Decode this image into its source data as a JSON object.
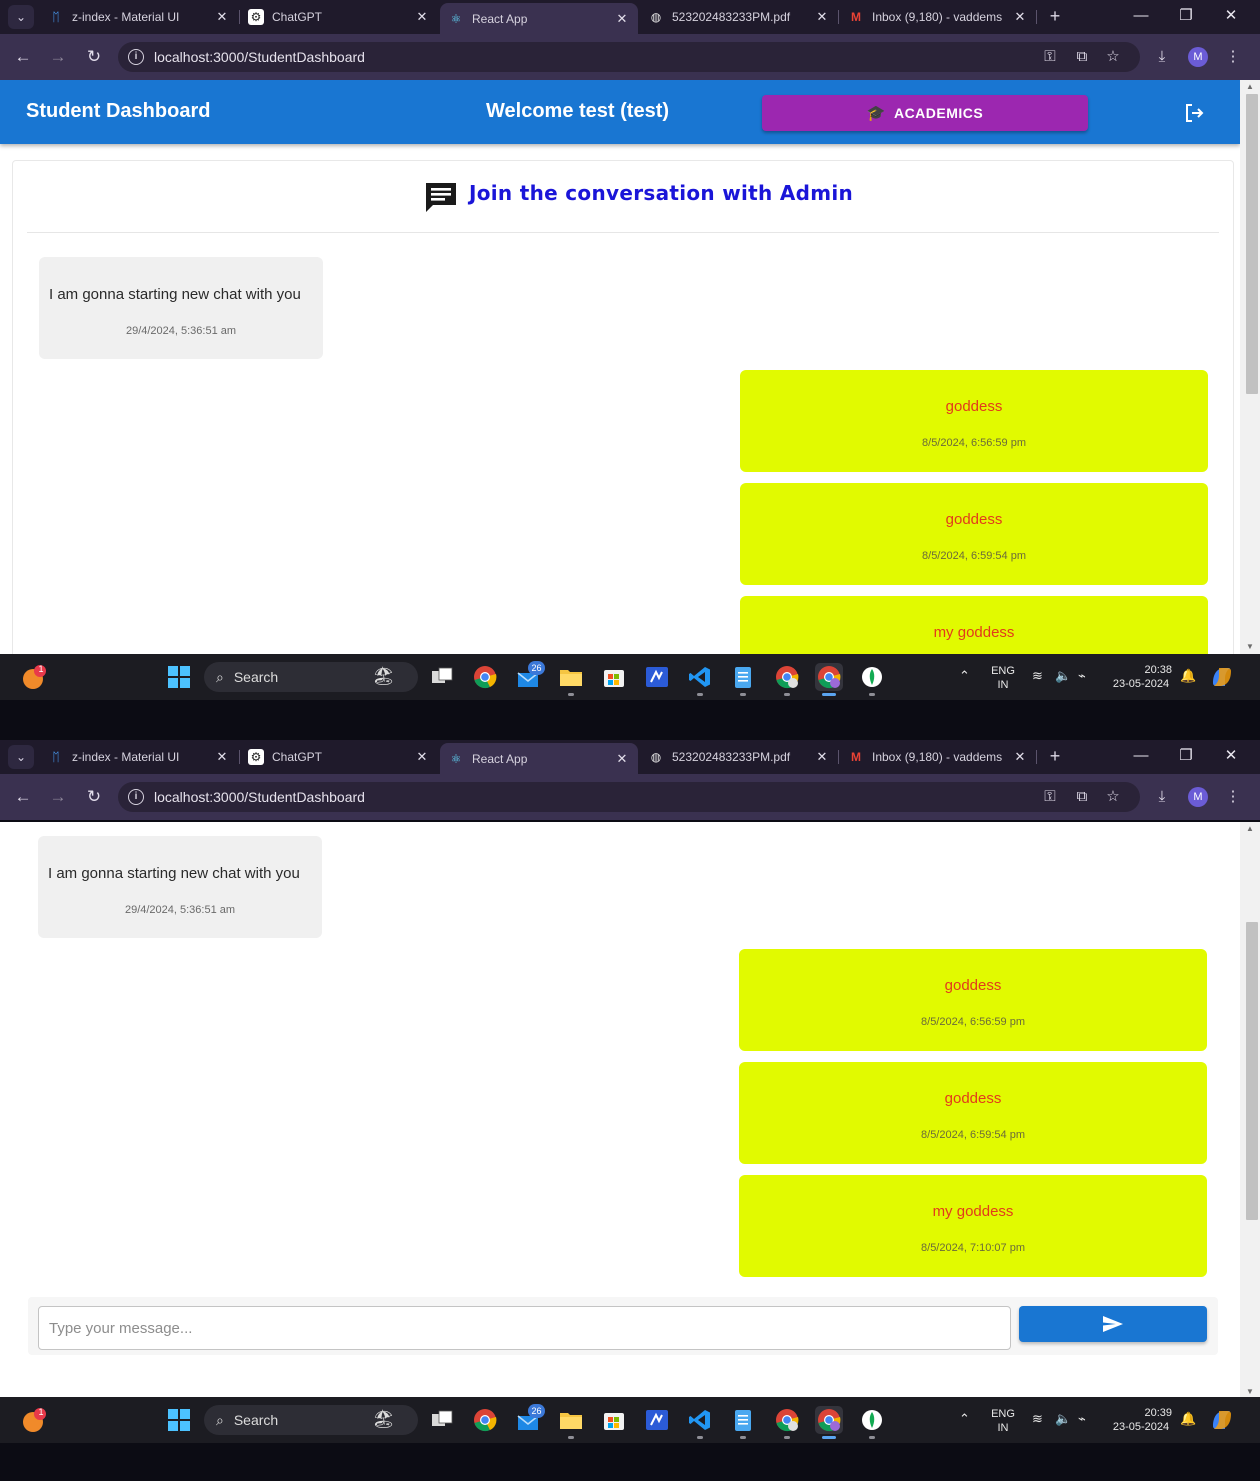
{
  "browser": {
    "tabs": [
      {
        "title": "z-index - Material UI",
        "favicon": "mui-icon"
      },
      {
        "title": "ChatGPT",
        "favicon": "chatgpt-icon"
      },
      {
        "title": "React App",
        "favicon": "react-icon"
      },
      {
        "title": "523202483233PM.pdf",
        "favicon": "globe-icon"
      },
      {
        "title": "Inbox (9,180) - vaddems",
        "favicon": "gmail-icon"
      }
    ],
    "active_tab": 2,
    "url": "localhost:3000/StudentDashboard",
    "profile_initial": "M"
  },
  "app": {
    "title": "Student Dashboard",
    "welcome": "Welcome test (test)",
    "academics_label": "ACADEMICS"
  },
  "chat": {
    "title": "Join the conversation with Admin",
    "messages": [
      {
        "side": "received",
        "text": "I am gonna starting new chat with you",
        "time": "29/4/2024, 5:36:51 am"
      },
      {
        "side": "sent",
        "text": "goddess",
        "time": "8/5/2024, 6:56:59 pm"
      },
      {
        "side": "sent",
        "text": "goddess",
        "time": "8/5/2024, 6:59:54 pm"
      },
      {
        "side": "sent",
        "text": "my goddess",
        "time": "8/5/2024, 7:10:07 pm"
      }
    ],
    "input_placeholder": "Type your message..."
  },
  "taskbar": {
    "search_label": "Search",
    "notification_badge": "1",
    "mail_badge": "26",
    "lang_top": "ENG",
    "lang_bottom": "IN",
    "screenshots": [
      {
        "time": "20:38",
        "date": "23-05-2024"
      },
      {
        "time": "20:39",
        "date": "23-05-2024"
      }
    ]
  },
  "colors": {
    "appbar": "#1976d2",
    "academics": "#9c27b0",
    "chat_title": "#1a15d8",
    "sent_bubble": "#e1fa00",
    "sent_text": "#e23b1b",
    "received_bubble": "#f0f0f0"
  }
}
